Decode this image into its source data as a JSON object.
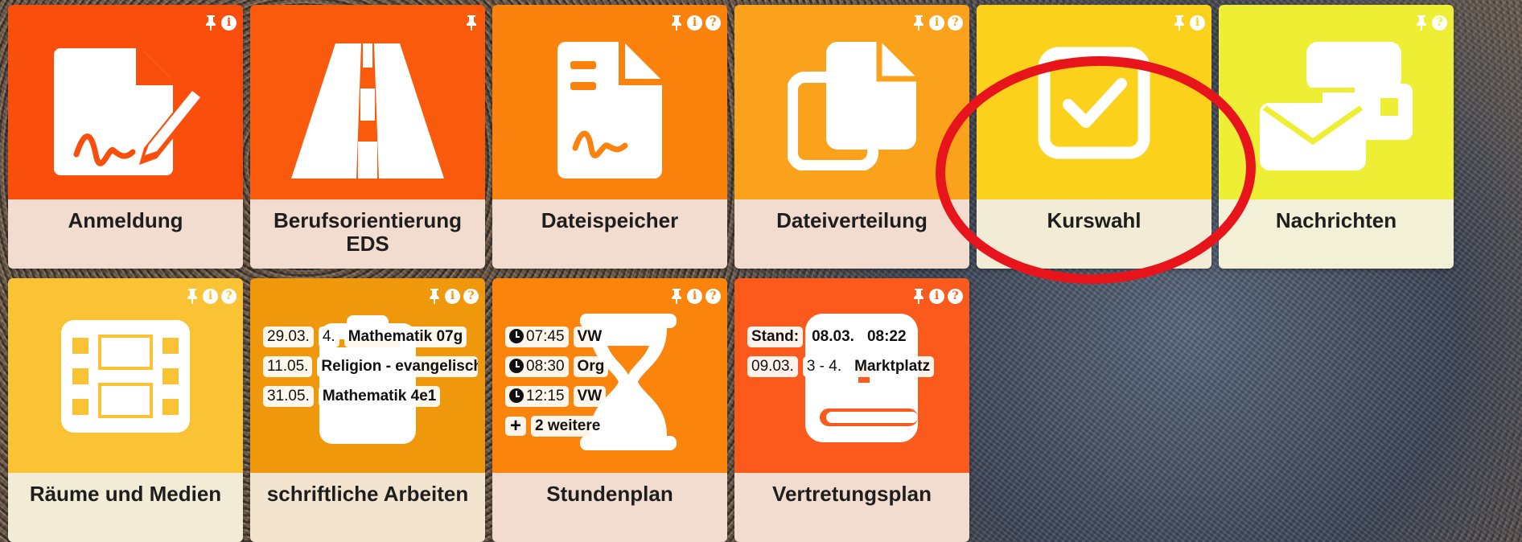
{
  "tiles": [
    {
      "label": "Anmeldung",
      "color": "#fa4e0c",
      "icon": "signed-document-icon",
      "pin": true,
      "info": true,
      "help": false
    },
    {
      "label": "Berufsorientierung EDS",
      "color": "#fa5a0c",
      "icon": "road-icon",
      "pin": true,
      "info": false,
      "help": false
    },
    {
      "label": "Dateispeicher",
      "color": "#fb820c",
      "icon": "file-icon",
      "pin": true,
      "info": true,
      "help": true
    },
    {
      "label": "Dateiverteilung",
      "color": "#fba21c",
      "icon": "copy-files-icon",
      "pin": true,
      "info": true,
      "help": true
    },
    {
      "label": "Kurswahl",
      "color": "#fbd11c",
      "icon": "checkbox-icon",
      "pin": true,
      "info": true,
      "help": false
    },
    {
      "label": "Nachrichten",
      "color": "#eeee35",
      "icon": "messages-icon",
      "pin": true,
      "info": false,
      "help": true
    },
    {
      "label": "Räume und Medien",
      "color": "#f9c335",
      "icon": "film-icon",
      "pin": true,
      "info": true,
      "help": true
    },
    {
      "label": "schriftliche Arbeiten",
      "color": "#f0980c",
      "icon": "clipboard-icon",
      "pin": true,
      "info": true,
      "help": true
    },
    {
      "label": "Stundenplan",
      "color": "#fb840c",
      "icon": "hourglass-icon",
      "pin": true,
      "info": true,
      "help": true
    },
    {
      "label": "Vertretungsplan",
      "color": "#fb5a1c",
      "icon": "book-icon",
      "pin": true,
      "info": true,
      "help": true
    }
  ],
  "icons": {
    "info_glyph": "i",
    "help_glyph": "?"
  },
  "arbeiten": [
    {
      "date": "29.03.",
      "lesson": "4.",
      "subject": "Mathematik 07g"
    },
    {
      "date": "11.05.",
      "lesson": "",
      "subject": "Religion - evangelisch"
    },
    {
      "date": "31.05.",
      "lesson": "",
      "subject": "Mathematik 4e1"
    }
  ],
  "stundenplan": [
    {
      "time": "07:45",
      "subject": "VW"
    },
    {
      "time": "08:30",
      "subject": "Org"
    },
    {
      "time": "12:15",
      "subject": "VW"
    }
  ],
  "stundenplan_more": "2 weitere",
  "vertretung": {
    "stand_label": "Stand:",
    "stand_date": "08.03.",
    "stand_time": "08:22",
    "entry_date": "09.03.",
    "entry_lessons": "3 - 4.",
    "entry_room": "Marktplatz"
  },
  "marker_color": "#e8141b"
}
